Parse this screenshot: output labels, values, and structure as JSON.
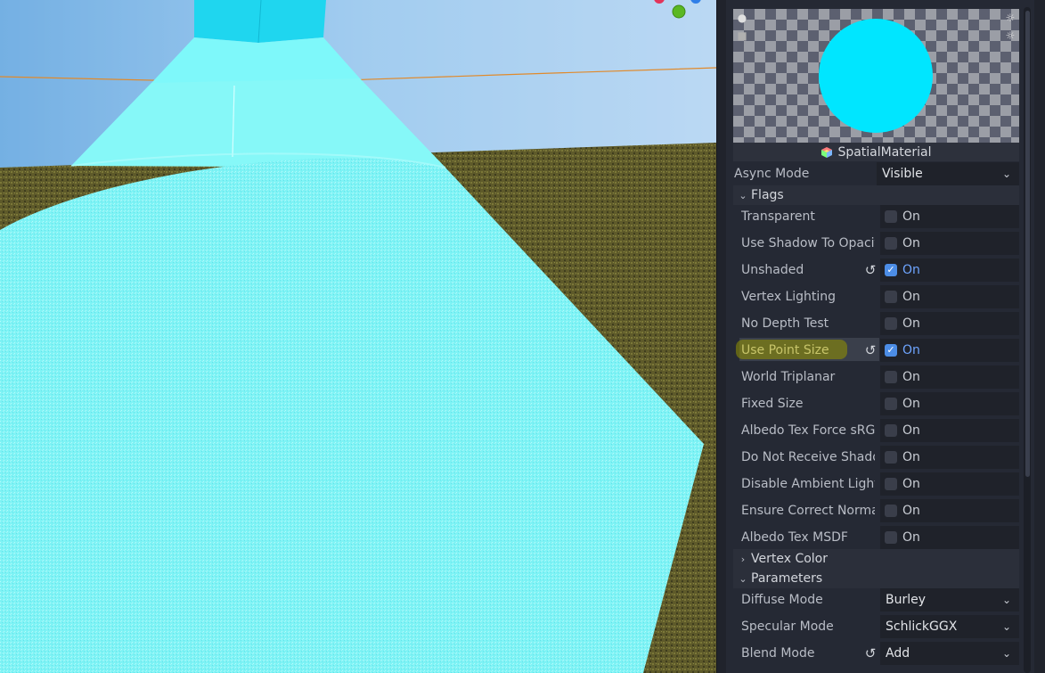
{
  "inspector": {
    "resource_name": "SpatialMaterial",
    "async_mode": {
      "label": "Async Mode",
      "value": "Visible"
    },
    "sections": {
      "flags": "Flags",
      "vertex_color": "Vertex Color",
      "parameters": "Parameters"
    },
    "flags": [
      {
        "label": "Transparent",
        "on_text": "On",
        "checked": false,
        "modified": false
      },
      {
        "label": "Use Shadow To Opacit",
        "on_text": "On",
        "checked": false,
        "modified": false
      },
      {
        "label": "Unshaded",
        "on_text": "On",
        "checked": true,
        "modified": true
      },
      {
        "label": "Vertex Lighting",
        "on_text": "On",
        "checked": false,
        "modified": false
      },
      {
        "label": "No Depth Test",
        "on_text": "On",
        "checked": false,
        "modified": false
      },
      {
        "label": "Use Point Size",
        "on_text": "On",
        "checked": true,
        "modified": true
      },
      {
        "label": "World Triplanar",
        "on_text": "On",
        "checked": false,
        "modified": false
      },
      {
        "label": "Fixed Size",
        "on_text": "On",
        "checked": false,
        "modified": false
      },
      {
        "label": "Albedo Tex Force sRG",
        "on_text": "On",
        "checked": false,
        "modified": false
      },
      {
        "label": "Do Not Receive Shado",
        "on_text": "On",
        "checked": false,
        "modified": false
      },
      {
        "label": "Disable Ambient Light",
        "on_text": "On",
        "checked": false,
        "modified": false
      },
      {
        "label": "Ensure Correct Norma",
        "on_text": "On",
        "checked": false,
        "modified": false
      },
      {
        "label": "Albedo Tex MSDF",
        "on_text": "On",
        "checked": false,
        "modified": false
      }
    ],
    "parameters": [
      {
        "label": "Diffuse Mode",
        "value": "Burley",
        "modified": false
      },
      {
        "label": "Specular Mode",
        "value": "SchlickGGX",
        "modified": false
      },
      {
        "label": "Blend Mode",
        "value": "Add",
        "modified": true
      }
    ]
  },
  "colors": {
    "sphere": "#00e6ff",
    "accent": "#4c8de6",
    "highlight": "#969600"
  }
}
